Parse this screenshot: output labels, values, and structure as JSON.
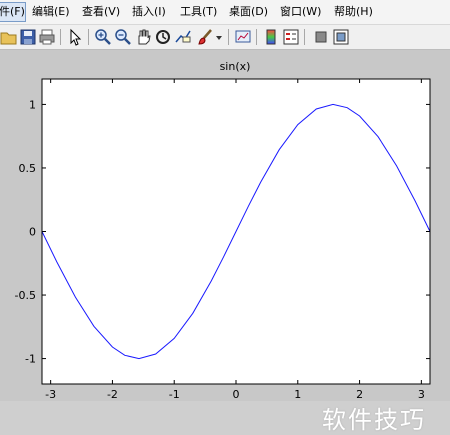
{
  "menubar": {
    "items": [
      {
        "label": "件(F)"
      },
      {
        "label": "编辑(E)"
      },
      {
        "label": "查看(V)"
      },
      {
        "label": "插入(I)"
      },
      {
        "label": "工具(T)"
      },
      {
        "label": "桌面(D)"
      },
      {
        "label": "窗口(W)"
      },
      {
        "label": "帮助(H)"
      }
    ]
  },
  "toolbar": {
    "icons": [
      "open-folder-icon",
      "save-icon",
      "print-icon",
      "pointer-icon",
      "zoom-in-icon",
      "zoom-out-icon",
      "pan-hand-icon",
      "rotate-3d-icon",
      "data-cursor-icon",
      "brush-icon",
      "dropdown-arrow-icon",
      "link-plot-icon",
      "colorbar-icon",
      "legend-icon",
      "hide-plot-tools-icon",
      "show-plot-tools-icon"
    ]
  },
  "colors": {
    "curve": "#1a1aff",
    "figure_bg": "#c8c8c8",
    "axes_bg": "#ffffff"
  },
  "watermark": "软件技巧",
  "chart_data": {
    "type": "line",
    "title": "sin(x)",
    "xlabel": "",
    "ylabel": "",
    "xlim": [
      -3.14,
      3.14
    ],
    "ylim": [
      -1.2,
      1.2
    ],
    "xticks": [
      -3,
      -2,
      -1,
      0,
      1,
      2,
      3
    ],
    "xtick_labels": [
      "-3",
      "-2",
      "-1",
      "0",
      "1",
      "2",
      "3"
    ],
    "yticks": [
      -1,
      -0.5,
      0,
      0.5,
      1
    ],
    "ytick_labels": [
      "-1",
      "-0.5",
      "0",
      "0.5",
      "1"
    ],
    "grid": false,
    "series": [
      {
        "x": [
          -3.14,
          -2.9,
          -2.6,
          -2.3,
          -2.0,
          -1.8,
          -1.57,
          -1.3,
          -1.0,
          -0.7,
          -0.4,
          -0.2,
          0,
          0.2,
          0.4,
          0.7,
          1.0,
          1.3,
          1.57,
          1.8,
          2.0,
          2.3,
          2.6,
          2.9,
          3.14
        ],
        "y": [
          0,
          -0.239,
          -0.516,
          -0.746,
          -0.909,
          -0.974,
          -1,
          -0.964,
          -0.841,
          -0.644,
          -0.389,
          -0.199,
          0,
          0.199,
          0.389,
          0.644,
          0.841,
          0.964,
          1,
          0.974,
          0.909,
          0.746,
          0.516,
          0.239,
          0
        ]
      }
    ]
  }
}
